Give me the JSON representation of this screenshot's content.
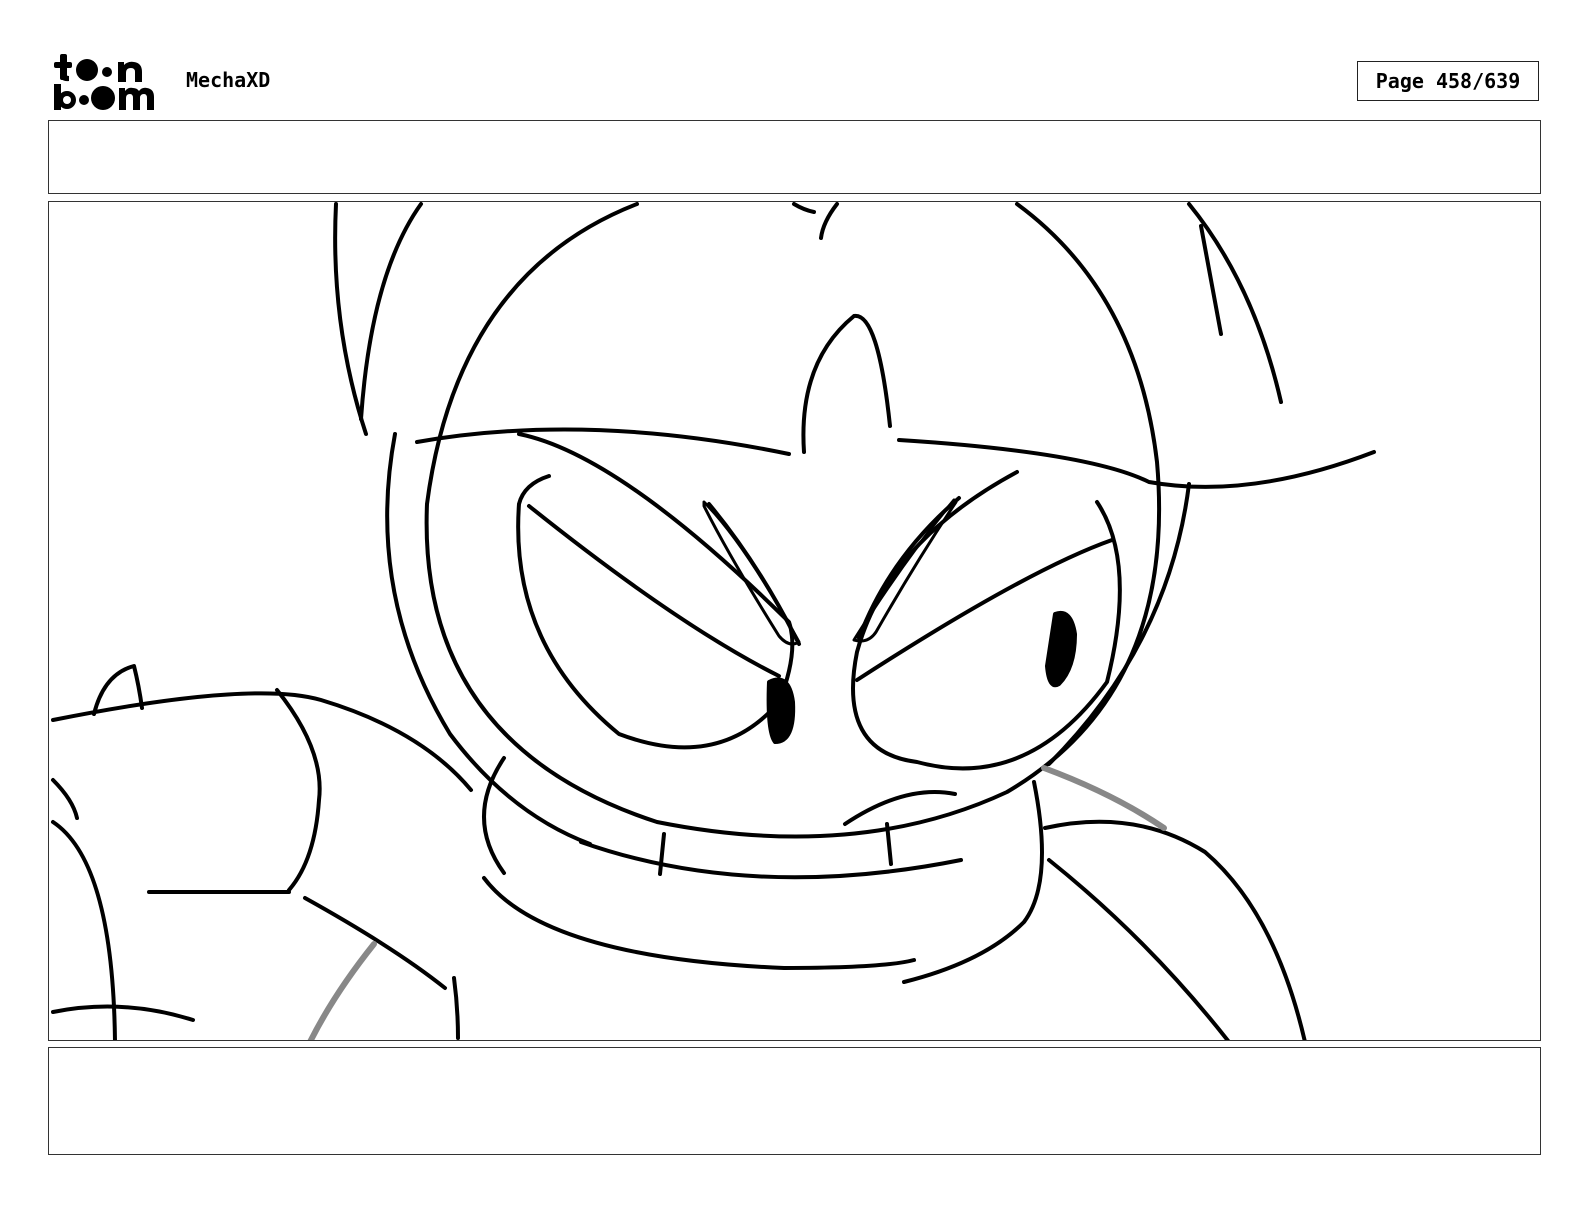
{
  "header": {
    "logo_icon": "toonboom-logo",
    "project_name": "MechaXD",
    "page_label": "Page 458/639"
  },
  "panel": {
    "action_notes": "",
    "dialogue_notes": "",
    "drawing": "rough-sketch-character-helmet-closeup"
  }
}
